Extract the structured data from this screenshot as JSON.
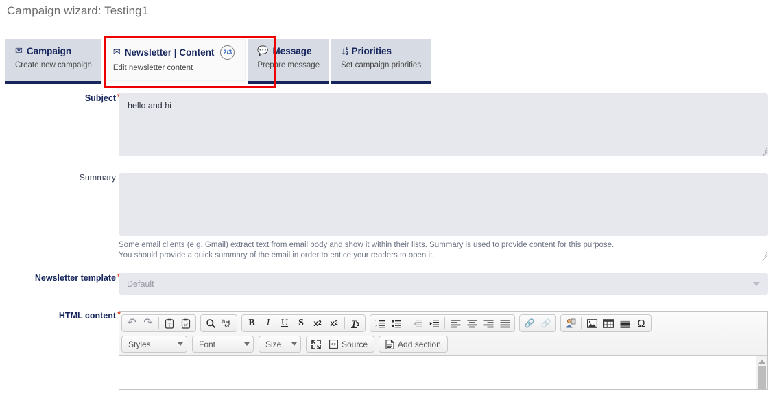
{
  "page": {
    "title": "Campaign wizard: Testing1"
  },
  "colors": {
    "navy": "#16265c",
    "tab_inactive_bg": "#d7dbe3",
    "tab_active_bg": "#fafafa",
    "highlight_red": "#ee0000",
    "field_bg": "#e7e7ee",
    "required_star": "#e23b1e",
    "badge_text": "#2b62b5"
  },
  "wizard_tabs": [
    {
      "id": "campaign",
      "icon": "envelope-icon",
      "title": "Campaign",
      "subtitle": "Create new campaign",
      "badge": "",
      "active": false
    },
    {
      "id": "newsletter-content",
      "icon": "envelope-icon",
      "title": "Newsletter | Content",
      "subtitle": "Edit newsletter content",
      "badge": "2/3",
      "active": true
    },
    {
      "id": "message",
      "icon": "speech-bubble-icon",
      "title": "Message",
      "subtitle": "Prepare message",
      "badge": "",
      "active": false
    },
    {
      "id": "priorities",
      "icon": "sort-numeric-icon",
      "title": "Priorities",
      "subtitle": "Set campaign priorities",
      "badge": "",
      "active": false
    }
  ],
  "form": {
    "subject": {
      "label": "Subject",
      "required": "*",
      "value": "hello and hi",
      "placeholder": ""
    },
    "summary": {
      "label": "Summary",
      "required": "",
      "value": "",
      "placeholder": "",
      "help_line1": "Some email clients (e.g. Gmail) extract text from email body and show it within their lists. Summary is used to provide content for this purpose.",
      "help_line2": "You should provide a quick summary of the email in order to entice your readers to open it."
    },
    "newsletter_template": {
      "label": "Newsletter template",
      "required": "*",
      "value": "Default"
    },
    "html_content": {
      "label": "HTML content",
      "required": "*"
    }
  },
  "editor": {
    "toolbar_row1": [
      {
        "group": "clipboard-history",
        "buttons": [
          {
            "name": "undo-icon",
            "glyph": "↶",
            "label": "Undo",
            "disabled": false
          },
          {
            "name": "redo-icon",
            "glyph": "↷",
            "label": "Redo",
            "disabled": false
          },
          {
            "name": "separator",
            "glyph": "",
            "label": "",
            "disabled": false
          },
          {
            "name": "paste-as-plain-text-icon",
            "glyph": "ὌB",
            "label": "Paste as plain text",
            "disabled": false
          },
          {
            "name": "paste-from-word-icon",
            "glyph": "ὌB",
            "label": "Paste from Word",
            "disabled": false
          }
        ]
      },
      {
        "group": "find-replace",
        "buttons": [
          {
            "name": "find-icon",
            "glyph": "🔍",
            "label": "Find",
            "disabled": false
          },
          {
            "name": "replace-icon",
            "glyph": "b→a",
            "label": "Replace",
            "disabled": false
          }
        ]
      },
      {
        "group": "basic-styles",
        "buttons": [
          {
            "name": "bold-icon",
            "glyph": "B",
            "label": "Bold",
            "disabled": false
          },
          {
            "name": "italic-icon",
            "glyph": "I",
            "label": "Italic",
            "disabled": false
          },
          {
            "name": "underline-icon",
            "glyph": "U",
            "label": "Underline",
            "disabled": false
          },
          {
            "name": "strikethrough-icon",
            "glyph": "S",
            "label": "Strike Through",
            "disabled": false
          },
          {
            "name": "subscript-icon",
            "glyph": "x",
            "label": "Subscript",
            "disabled": false
          },
          {
            "name": "superscript-icon",
            "glyph": "x",
            "label": "Superscript",
            "disabled": false
          },
          {
            "name": "separator",
            "glyph": "",
            "label": "",
            "disabled": false
          },
          {
            "name": "remove-format-icon",
            "glyph": "T",
            "label": "Remove Format",
            "disabled": false
          }
        ]
      },
      {
        "group": "paragraph",
        "buttons": [
          {
            "name": "numbered-list-icon",
            "glyph": "",
            "label": "Insert/Remove Numbered List",
            "disabled": false
          },
          {
            "name": "bulleted-list-icon",
            "glyph": "",
            "label": "Insert/Remove Bulleted List",
            "disabled": false
          },
          {
            "name": "separator",
            "glyph": "",
            "label": "",
            "disabled": false
          },
          {
            "name": "decrease-indent-icon",
            "glyph": "",
            "label": "Decrease Indent",
            "disabled": true
          },
          {
            "name": "increase-indent-icon",
            "glyph": "",
            "label": "Increase Indent",
            "disabled": false
          },
          {
            "name": "separator",
            "glyph": "",
            "label": "",
            "disabled": false
          },
          {
            "name": "align-left-icon",
            "glyph": "",
            "label": "Align Left",
            "disabled": false
          },
          {
            "name": "align-center-icon",
            "glyph": "",
            "label": "Center",
            "disabled": false
          },
          {
            "name": "align-right-icon",
            "glyph": "",
            "label": "Align Right",
            "disabled": false
          },
          {
            "name": "justify-icon",
            "glyph": "",
            "label": "Justify",
            "disabled": false
          }
        ]
      },
      {
        "group": "links",
        "buttons": [
          {
            "name": "link-icon",
            "glyph": "⚭",
            "label": "Link",
            "disabled": false
          },
          {
            "name": "unlink-icon",
            "glyph": "⚭",
            "label": "Unlink",
            "disabled": true
          }
        ]
      },
      {
        "group": "insert",
        "buttons": [
          {
            "name": "personalize-icon",
            "glyph": "",
            "label": "Personalize",
            "disabled": false
          },
          {
            "name": "separator",
            "glyph": "",
            "label": "",
            "disabled": false
          },
          {
            "name": "image-icon",
            "glyph": "",
            "label": "Image",
            "disabled": false
          },
          {
            "name": "table-icon",
            "glyph": "",
            "label": "Table",
            "disabled": false
          },
          {
            "name": "horizontal-rule-icon",
            "glyph": "",
            "label": "Horizontal Line",
            "disabled": false
          },
          {
            "name": "special-character-icon",
            "glyph": "Ω",
            "label": "Insert Special Character",
            "disabled": false
          }
        ]
      }
    ],
    "toolbar_row2": {
      "combos": [
        {
          "name": "styles-combo",
          "label": "Styles"
        },
        {
          "name": "font-combo",
          "label": "Font"
        },
        {
          "name": "size-combo",
          "label": "Size"
        }
      ],
      "buttons": [
        {
          "name": "maximize-icon",
          "label": ""
        },
        {
          "name": "source-button",
          "label": "Source"
        },
        {
          "name": "add-section-button",
          "label": "Add section"
        }
      ]
    },
    "content": ""
  }
}
